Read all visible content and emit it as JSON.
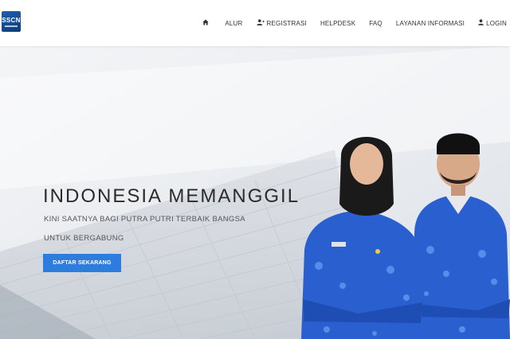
{
  "brand": {
    "logo_text": "SSCN"
  },
  "nav": {
    "items": [
      {
        "label": "",
        "icon": "home-icon"
      },
      {
        "label": "ALUR"
      },
      {
        "label": "REGISTRASI",
        "icon": "user-plus-icon"
      },
      {
        "label": "HELPDESK"
      },
      {
        "label": "FAQ"
      },
      {
        "label": "LAYANAN INFORMASI"
      },
      {
        "label": "LOGIN",
        "icon": "user-icon"
      }
    ]
  },
  "hero": {
    "title": "INDONESIA MEMANGGIL",
    "subtitle_line1": "KINI SAATNYA BAGI PUTRA PUTRI TERBAIK BANGSA",
    "subtitle_line2": "UNTUK BERGABUNG",
    "cta_label": "DAFTAR SEKARANG"
  },
  "colors": {
    "accent": "#2d7de0",
    "batik_blue": "#2a5fd0",
    "hijab": "#1a1a1a",
    "text": "#2b2b2b"
  }
}
